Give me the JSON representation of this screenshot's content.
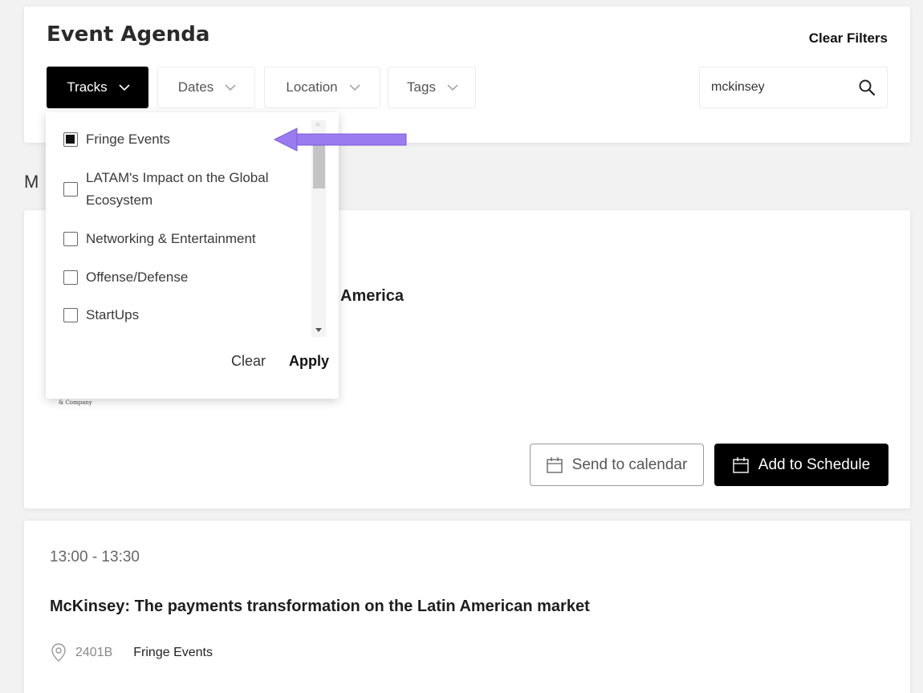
{
  "header": {
    "title": "Event Agenda",
    "clear_filters": "Clear Filters",
    "filters": [
      {
        "label": "Tracks",
        "active": true
      },
      {
        "label": "Dates",
        "active": false
      },
      {
        "label": "Location",
        "active": false
      },
      {
        "label": "Tags",
        "active": false
      }
    ],
    "search": {
      "value": "mckinsey",
      "icon": "search-icon"
    }
  },
  "section_label": "M",
  "tracks_dropdown": {
    "items": [
      {
        "label": "Fringe Events",
        "checked": true
      },
      {
        "label": "LATAM's Impact on the Global Ecosystem",
        "checked": false
      },
      {
        "label": "Networking & Entertainment",
        "checked": false
      },
      {
        "label": "Offense/Defense",
        "checked": false
      },
      {
        "label": "StartUps",
        "checked": false
      }
    ],
    "clear": "Clear",
    "apply": "Apply"
  },
  "annotation": {
    "color": "#9a7bf0",
    "icon": "arrow-left"
  },
  "event1": {
    "title_tail": "America",
    "logo_text": "& Company",
    "send_to_calendar": "Send to calendar",
    "add_to_schedule": "Add to Schedule"
  },
  "event2": {
    "time": "13:00 - 13:30",
    "title": "McKinsey: The payments transformation on the Latin American market",
    "room": "2401B",
    "track": "Fringe Events",
    "location_icon": "map-pin-icon"
  },
  "colors": {
    "background": "#f2f2f2",
    "primary_button": "#000000",
    "accent": "#9a7bf0"
  }
}
